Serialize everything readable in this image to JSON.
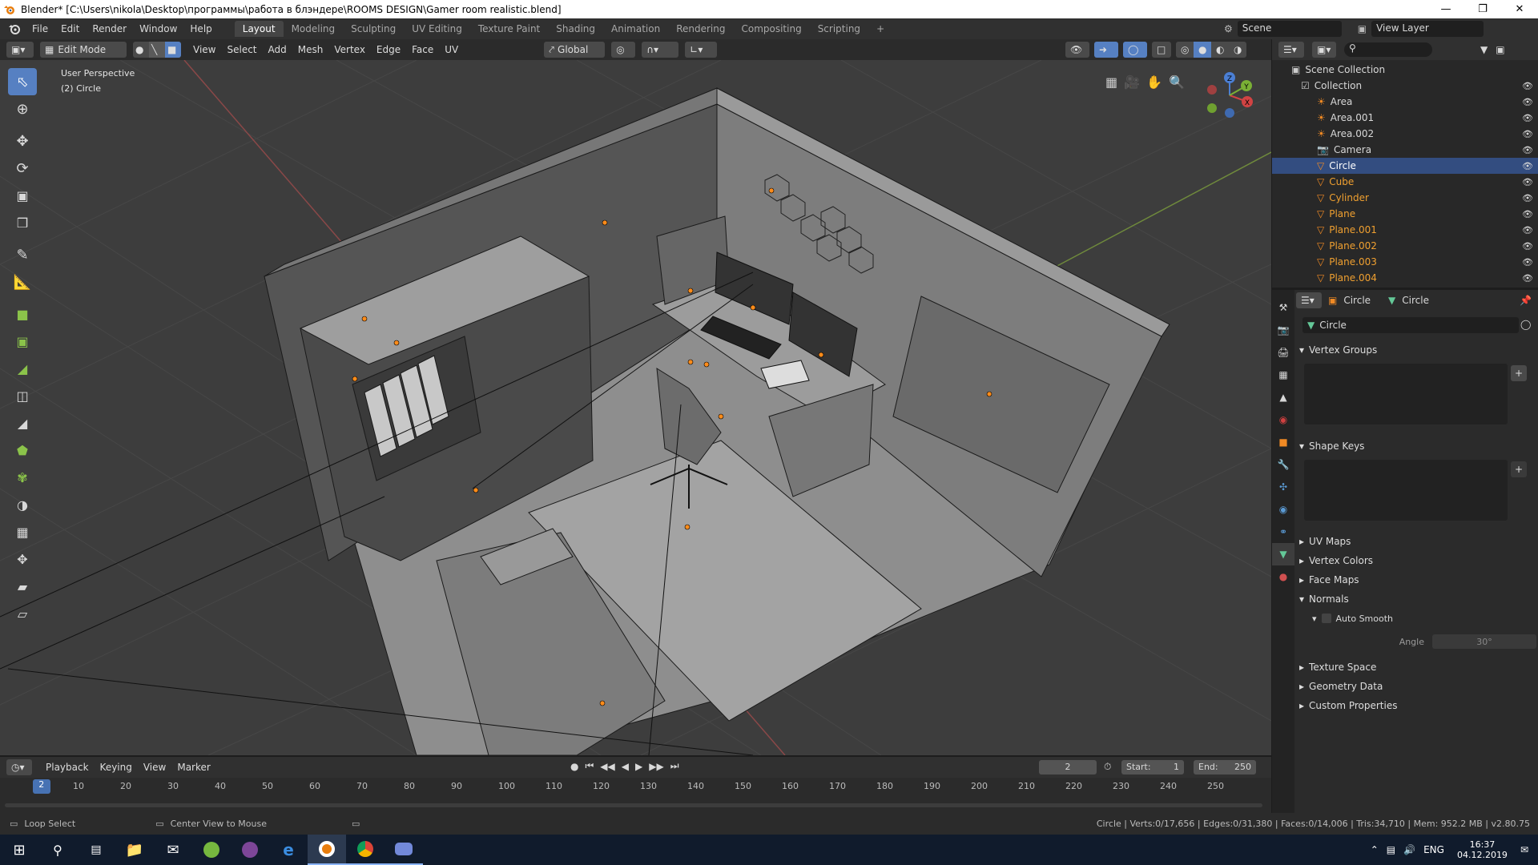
{
  "window": {
    "title": "Blender* [C:\\Users\\nikola\\Desktop\\программы\\работа в блэндере\\ROOMS DESIGN\\Gamer room realistic.blend]"
  },
  "menu": [
    "File",
    "Edit",
    "Render",
    "Window",
    "Help"
  ],
  "workspaces": [
    "Layout",
    "Modeling",
    "Sculpting",
    "UV Editing",
    "Texture Paint",
    "Shading",
    "Animation",
    "Rendering",
    "Compositing",
    "Scripting"
  ],
  "scene": {
    "label": "Scene",
    "view_layer": "View Layer"
  },
  "viewport": {
    "mode": "Edit Mode",
    "menus": [
      "View",
      "Select",
      "Add",
      "Mesh",
      "Vertex",
      "Edge",
      "Face",
      "UV"
    ],
    "orientation": "Global",
    "overlay_title": "User Perspective",
    "overlay_object": "(2) Circle",
    "gizmo_axes": {
      "x": "X",
      "y": "Y",
      "z": "Z"
    }
  },
  "outliner": {
    "scene_collection": "Scene Collection",
    "collection": "Collection",
    "items": [
      {
        "name": "Area",
        "type": "light"
      },
      {
        "name": "Area.001",
        "type": "light"
      },
      {
        "name": "Area.002",
        "type": "light"
      },
      {
        "name": "Camera",
        "type": "camera"
      },
      {
        "name": "Circle",
        "type": "mesh",
        "selected": true
      },
      {
        "name": "Cube",
        "type": "mesh"
      },
      {
        "name": "Cylinder",
        "type": "mesh"
      },
      {
        "name": "Plane",
        "type": "mesh"
      },
      {
        "name": "Plane.001",
        "type": "mesh"
      },
      {
        "name": "Plane.002",
        "type": "mesh"
      },
      {
        "name": "Plane.003",
        "type": "mesh"
      },
      {
        "name": "Plane.004",
        "type": "mesh"
      }
    ]
  },
  "properties": {
    "breadcrumb_object": "Circle",
    "breadcrumb_data": "Circle",
    "data_name": "Circle",
    "panels": {
      "vertex_groups": "Vertex Groups",
      "shape_keys": "Shape Keys",
      "uv_maps": "UV Maps",
      "vertex_colors": "Vertex Colors",
      "face_maps": "Face Maps",
      "normals": "Normals",
      "auto_smooth": "Auto Smooth",
      "angle_label": "Angle",
      "angle_value": "30°",
      "texture_space": "Texture Space",
      "geometry_data": "Geometry Data",
      "custom_properties": "Custom Properties"
    }
  },
  "timeline": {
    "menus": [
      "Playback",
      "Keying",
      "View",
      "Marker"
    ],
    "current_frame": "2",
    "start_label": "Start:",
    "start": "1",
    "end_label": "End:",
    "end": "250",
    "ruler": [
      "10",
      "20",
      "30",
      "40",
      "50",
      "60",
      "70",
      "80",
      "90",
      "100",
      "110",
      "120",
      "130",
      "140",
      "150",
      "160",
      "170",
      "180",
      "190",
      "200",
      "210",
      "220",
      "230",
      "240",
      "250"
    ],
    "cursor": "2"
  },
  "status": {
    "left_action": "Loop Select",
    "mid_action": "Center View to Mouse",
    "stats": "Circle | Verts:0/17,656 | Edges:0/31,380 | Faces:0/14,006 | Tris:34,710 | Mem: 952.2 MB | v2.80.75"
  },
  "taskbar": {
    "lang": "ENG",
    "time": "16:37",
    "date": "04.12.2019"
  },
  "colors": {
    "accent": "#5680c2",
    "selection": "#334d80",
    "active_object": "#ffaf29",
    "viewport_bg": "#3d3d3d"
  }
}
